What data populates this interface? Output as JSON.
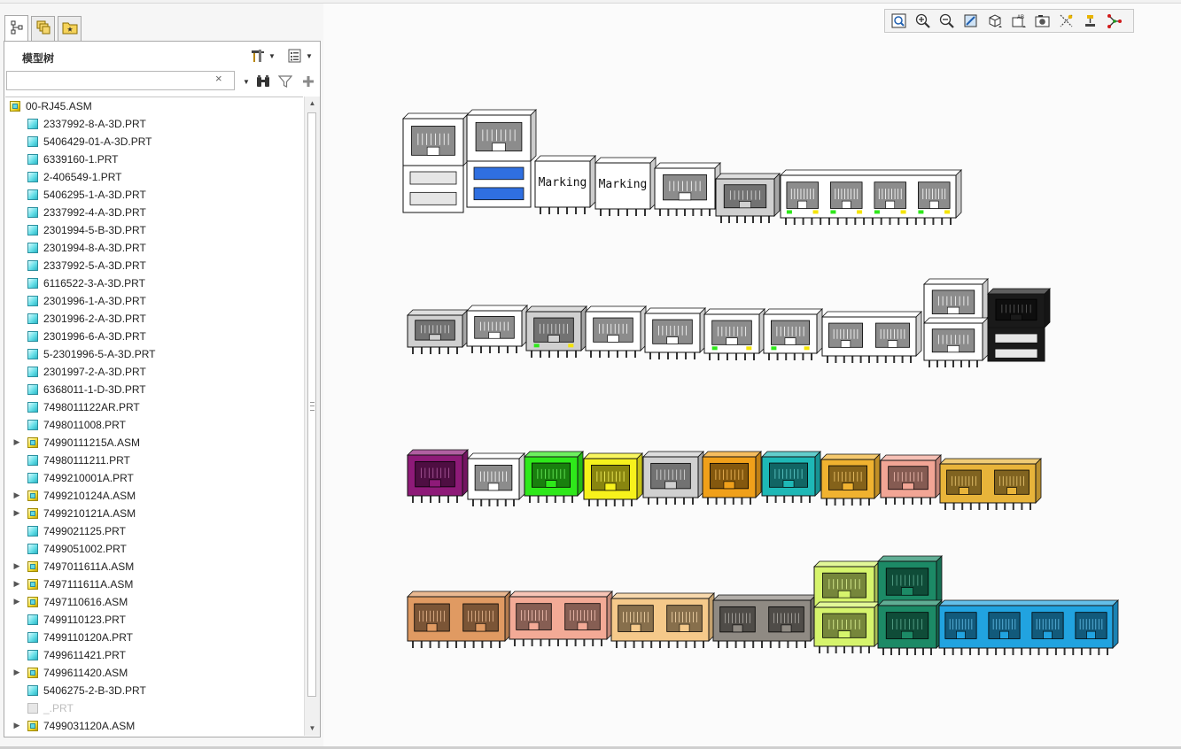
{
  "panel": {
    "tabs": [
      {
        "name": "model-tree-tab",
        "icon": "model-tree-icon"
      },
      {
        "name": "layers-tab",
        "icon": "layers-icon"
      },
      {
        "name": "favorites-tab",
        "icon": "folder-star-icon"
      }
    ],
    "tree_title": "模型树",
    "search_value": "",
    "search_clear": "×"
  },
  "tree": {
    "root": "00-RJ45.ASM",
    "items": [
      {
        "label": "2337992-8-A-3D.PRT",
        "type": "part"
      },
      {
        "label": "5406429-01-A-3D.PRT",
        "type": "part"
      },
      {
        "label": "6339160-1.PRT",
        "type": "part"
      },
      {
        "label": "2-406549-1.PRT",
        "type": "part"
      },
      {
        "label": "5406295-1-A-3D.PRT",
        "type": "part"
      },
      {
        "label": "2337992-4-A-3D.PRT",
        "type": "part"
      },
      {
        "label": "2301994-5-B-3D.PRT",
        "type": "part"
      },
      {
        "label": "2301994-8-A-3D.PRT",
        "type": "part"
      },
      {
        "label": "2337992-5-A-3D.PRT",
        "type": "part"
      },
      {
        "label": "6116522-3-A-3D.PRT",
        "type": "part"
      },
      {
        "label": "2301996-1-A-3D.PRT",
        "type": "part"
      },
      {
        "label": "2301996-2-A-3D.PRT",
        "type": "part"
      },
      {
        "label": "2301996-6-A-3D.PRT",
        "type": "part"
      },
      {
        "label": "5-2301996-5-A-3D.PRT",
        "type": "part"
      },
      {
        "label": "2301997-2-A-3D.PRT",
        "type": "part"
      },
      {
        "label": "6368011-1-D-3D.PRT",
        "type": "part"
      },
      {
        "label": "7498011122AR.PRT",
        "type": "part"
      },
      {
        "label": "7498011008.PRT",
        "type": "part"
      },
      {
        "label": "74990111215A.ASM",
        "type": "asm"
      },
      {
        "label": "74980111211.PRT",
        "type": "part"
      },
      {
        "label": "7499210001A.PRT",
        "type": "part"
      },
      {
        "label": "7499210124A.ASM",
        "type": "asm"
      },
      {
        "label": "7499210121A.ASM",
        "type": "asm"
      },
      {
        "label": "7499021125.PRT",
        "type": "part"
      },
      {
        "label": "7499051002.PRT",
        "type": "part"
      },
      {
        "label": "7497011611A.ASM",
        "type": "asm"
      },
      {
        "label": "7497111611A.ASM",
        "type": "asm"
      },
      {
        "label": "7497110616.ASM",
        "type": "asm"
      },
      {
        "label": "7499110123.PRT",
        "type": "part"
      },
      {
        "label": "7499110120A.PRT",
        "type": "part"
      },
      {
        "label": "7499611421.PRT",
        "type": "part"
      },
      {
        "label": "7499611420.ASM",
        "type": "asm"
      },
      {
        "label": "5406275-2-B-3D.PRT",
        "type": "part"
      },
      {
        "label": "_.PRT",
        "type": "dim"
      },
      {
        "label": "7499031120A.ASM",
        "type": "asm"
      }
    ]
  },
  "view_toolbar": [
    {
      "name": "refit-button",
      "icon": "zoom-fit-icon"
    },
    {
      "name": "zoom-in-button",
      "icon": "zoom-in-icon"
    },
    {
      "name": "zoom-out-button",
      "icon": "zoom-out-icon"
    },
    {
      "name": "repaint-button",
      "icon": "repaint-icon"
    },
    {
      "name": "display-style-button",
      "icon": "shaded-cube-icon"
    },
    {
      "name": "saved-views-button",
      "icon": "saved-views-icon"
    },
    {
      "name": "view-manager-button",
      "icon": "camera-icon"
    },
    {
      "name": "datum-display-button",
      "icon": "datum-display-icon"
    },
    {
      "name": "annotation-display-button",
      "icon": "annotation-display-icon"
    },
    {
      "name": "spin-center-button",
      "icon": "spin-center-icon"
    }
  ],
  "model": {
    "marking_label": "Marking",
    "colors": {
      "magenta": "#8e1a78",
      "green": "#2ee81a",
      "yellow": "#f7f21c",
      "orange": "#f0a01a",
      "teal": "#1eb8b6",
      "gold": "#f0b230",
      "salmon": "#f2a595",
      "amber": "#e8b43a",
      "tan": "#e09a62",
      "pink": "#f3aa96",
      "peach": "#f5c98a",
      "gray": "#8f8a83",
      "lime": "#d6f46c",
      "darkgreen": "#1c8a66",
      "blue": "#21a3e0",
      "black": "#1a1a1a",
      "white": "#ffffff",
      "silver": "#d0d0d0"
    }
  }
}
